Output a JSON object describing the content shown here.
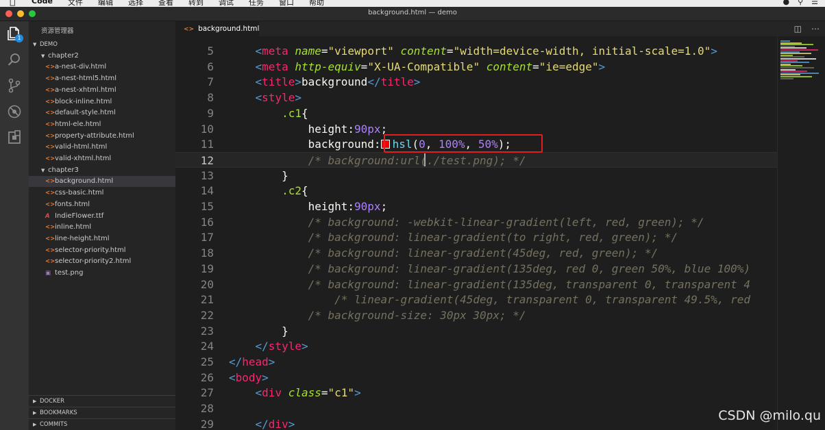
{
  "menubar": {
    "menus": [
      "Code",
      "文件",
      "编辑",
      "选择",
      "查看",
      "转到",
      "调试",
      "任务",
      "窗口",
      "帮助"
    ]
  },
  "window": {
    "title": "background.html — demo"
  },
  "explorer": {
    "title": "资源管理器",
    "workspace": "DEMO",
    "folders": [
      {
        "name": "chapter2",
        "files": [
          "a-nest-div.html",
          "a-nest-html5.html",
          "a-nest-xhtml.html",
          "block-inline.html",
          "default-style.html",
          "html-ele.html",
          "property-attribute.html",
          "valid-html.html",
          "valid-xhtml.html"
        ]
      },
      {
        "name": "chapter3",
        "files": [
          "background.html",
          "css-basic.html",
          "fonts.html",
          "IndieFlower.ttf",
          "inline.html",
          "line-height.html",
          "selector-priority.html",
          "selector-priority2.html",
          "test.png"
        ]
      }
    ],
    "selected_file": "background.html",
    "bottom_sections": [
      "DOCKER",
      "BOOKMARKS",
      "COMMITS"
    ]
  },
  "activity_badge": "1",
  "tabs": [
    {
      "label": "background.html"
    }
  ],
  "editor": {
    "current_line": 12,
    "lines": [
      {
        "n": "5",
        "tokens": [
          [
            "    ",
            "pl"
          ],
          [
            "<",
            "tag"
          ],
          [
            "meta",
            "tg"
          ],
          [
            " ",
            "pl"
          ],
          [
            "name",
            "attr"
          ],
          [
            "=",
            "pl"
          ],
          [
            "\"viewport\"",
            "str"
          ],
          [
            " ",
            "pl"
          ],
          [
            "content",
            "attr"
          ],
          [
            "=",
            "pl"
          ],
          [
            "\"width=device-width, initial-scale=1.0\"",
            "str"
          ],
          [
            ">",
            "tag"
          ]
        ]
      },
      {
        "n": "6",
        "tokens": [
          [
            "    ",
            "pl"
          ],
          [
            "<",
            "tag"
          ],
          [
            "meta",
            "tg"
          ],
          [
            " ",
            "pl"
          ],
          [
            "http-equiv",
            "attr"
          ],
          [
            "=",
            "pl"
          ],
          [
            "\"X-UA-Compatible\"",
            "str"
          ],
          [
            " ",
            "pl"
          ],
          [
            "content",
            "attr"
          ],
          [
            "=",
            "pl"
          ],
          [
            "\"ie=edge\"",
            "str"
          ],
          [
            ">",
            "tag"
          ]
        ]
      },
      {
        "n": "7",
        "tokens": [
          [
            "    ",
            "pl"
          ],
          [
            "<",
            "tag"
          ],
          [
            "title",
            "tg"
          ],
          [
            ">",
            "tag"
          ],
          [
            "background",
            "pl"
          ],
          [
            "</",
            "tag"
          ],
          [
            "title",
            "tg"
          ],
          [
            ">",
            "tag"
          ]
        ]
      },
      {
        "n": "8",
        "tokens": [
          [
            "    ",
            "pl"
          ],
          [
            "<",
            "tag"
          ],
          [
            "style",
            "tg"
          ],
          [
            ">",
            "tag"
          ]
        ]
      },
      {
        "n": "9",
        "tokens": [
          [
            "        ",
            "pl"
          ],
          [
            ".c1",
            "sel"
          ],
          [
            "{",
            "pl"
          ]
        ]
      },
      {
        "n": "10",
        "tokens": [
          [
            "            ",
            "pl"
          ],
          [
            "height",
            "prop"
          ],
          [
            ":",
            "pl"
          ],
          [
            "90px",
            "num"
          ],
          [
            ";",
            "pl"
          ]
        ]
      },
      {
        "n": "11",
        "tokens": [
          [
            "            ",
            "pl"
          ],
          [
            "background",
            "prop"
          ],
          [
            ":",
            "pl"
          ],
          [
            "SWATCH",
            "swatch"
          ],
          [
            "hsl",
            "fn"
          ],
          [
            "(",
            "pl"
          ],
          [
            "0",
            "num"
          ],
          [
            ", ",
            "pl"
          ],
          [
            "100%",
            "num"
          ],
          [
            ", ",
            "pl"
          ],
          [
            "50%",
            "num"
          ],
          [
            ");",
            "pl"
          ]
        ]
      },
      {
        "n": "12",
        "tokens": [
          [
            "            ",
            "pl"
          ],
          [
            "/* background:url(./test.png); */",
            "cm"
          ]
        ]
      },
      {
        "n": "13",
        "tokens": [
          [
            "        ",
            "pl"
          ],
          [
            "}",
            "pl"
          ]
        ]
      },
      {
        "n": "14",
        "tokens": [
          [
            "        ",
            "pl"
          ],
          [
            ".c2",
            "sel"
          ],
          [
            "{",
            "pl"
          ]
        ]
      },
      {
        "n": "15",
        "tokens": [
          [
            "            ",
            "pl"
          ],
          [
            "height",
            "prop"
          ],
          [
            ":",
            "pl"
          ],
          [
            "90px",
            "num"
          ],
          [
            ";",
            "pl"
          ]
        ]
      },
      {
        "n": "16",
        "tokens": [
          [
            "            ",
            "pl"
          ],
          [
            "/* background: -webkit-linear-gradient(left, red, green); */",
            "cm"
          ]
        ]
      },
      {
        "n": "17",
        "tokens": [
          [
            "            ",
            "pl"
          ],
          [
            "/* background: linear-gradient(to right, red, green); */",
            "cm"
          ]
        ]
      },
      {
        "n": "18",
        "tokens": [
          [
            "            ",
            "pl"
          ],
          [
            "/* background: linear-gradient(45deg, red, green); */",
            "cm"
          ]
        ]
      },
      {
        "n": "19",
        "tokens": [
          [
            "            ",
            "pl"
          ],
          [
            "/* background: linear-gradient(135deg, red 0, green 50%, blue 100%)",
            "cm"
          ]
        ]
      },
      {
        "n": "20",
        "tokens": [
          [
            "            ",
            "pl"
          ],
          [
            "/* background: linear-gradient(135deg, transparent 0, transparent 4",
            "cm"
          ]
        ]
      },
      {
        "n": "21",
        "tokens": [
          [
            "                ",
            "pl"
          ],
          [
            "/* linear-gradient(45deg, transparent 0, transparent 49.5%, red",
            "cm"
          ]
        ]
      },
      {
        "n": "22",
        "tokens": [
          [
            "            ",
            "pl"
          ],
          [
            "/* background-size: 30px 30px; */",
            "cm"
          ]
        ]
      },
      {
        "n": "23",
        "tokens": [
          [
            "        ",
            "pl"
          ],
          [
            "}",
            "pl"
          ]
        ]
      },
      {
        "n": "24",
        "tokens": [
          [
            "    ",
            "pl"
          ],
          [
            "</",
            "tag"
          ],
          [
            "style",
            "tg"
          ],
          [
            ">",
            "tag"
          ]
        ]
      },
      {
        "n": "25",
        "tokens": [
          [
            "</",
            "tag"
          ],
          [
            "head",
            "tg"
          ],
          [
            ">",
            "tag"
          ]
        ]
      },
      {
        "n": "26",
        "tokens": [
          [
            "<",
            "tag"
          ],
          [
            "body",
            "tg"
          ],
          [
            ">",
            "tag"
          ]
        ]
      },
      {
        "n": "27",
        "tokens": [
          [
            "    ",
            "pl"
          ],
          [
            "<",
            "tag"
          ],
          [
            "div",
            "tg"
          ],
          [
            " ",
            "pl"
          ],
          [
            "class",
            "attr"
          ],
          [
            "=",
            "pl"
          ],
          [
            "\"c1\"",
            "str"
          ],
          [
            ">",
            "tag"
          ]
        ]
      },
      {
        "n": "28",
        "tokens": []
      },
      {
        "n": "29",
        "tokens": [
          [
            "    ",
            "pl"
          ],
          [
            "</",
            "tag"
          ],
          [
            "div",
            "tg"
          ],
          [
            ">",
            "tag"
          ]
        ]
      }
    ]
  },
  "colors": {
    "editor_bg": "#1e1e1e",
    "swatch": "#ff0000",
    "highlight_box": "#e02020"
  },
  "watermark": "CSDN @milo.qu"
}
